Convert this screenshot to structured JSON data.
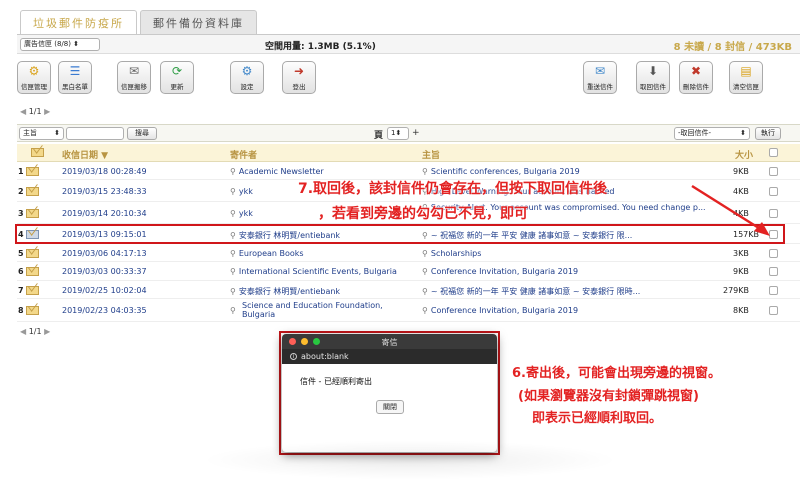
{
  "tabs": [
    {
      "label": "垃圾郵件防疫所",
      "active": true
    },
    {
      "label": "郵件備份資料庫",
      "active": false
    }
  ],
  "topbar": {
    "folder_select": "廣告信匣 (8/8)",
    "quota_label": "空間用量: 1.3MB (5.1%)",
    "mail_count": "8 未讀 / 8 封信 / 473KB"
  },
  "toolbar": {
    "buttons": [
      {
        "label": "信匣管理",
        "icon": "folder-manage-icon"
      },
      {
        "label": "黑白名單",
        "icon": "list-icon"
      },
      {
        "label": "信匣搬移",
        "icon": "move-icon"
      },
      {
        "label": "更新",
        "icon": "refresh-icon"
      },
      {
        "label": "設定",
        "icon": "gear-icon"
      },
      {
        "label": "登出",
        "icon": "logout-icon"
      },
      {
        "label": "重送信件",
        "icon": "resend-icon"
      },
      {
        "label": "取回信件",
        "icon": "retrieve-icon"
      },
      {
        "label": "刪除信件",
        "icon": "delete-icon"
      },
      {
        "label": "清空信匣",
        "icon": "empty-folder-icon"
      }
    ]
  },
  "pager": {
    "page": "1/1"
  },
  "filterbar": {
    "field_select": "主旨",
    "search_value": "",
    "search_button": "搜尋",
    "page_label": "頁",
    "page_select": "1",
    "page_plus": "+",
    "action_select": "-取回信件-",
    "execute_button": "執行"
  },
  "table": {
    "headers": {
      "date": "收信日期",
      "sender": "寄件者",
      "subject": "主旨",
      "size": "大小"
    },
    "rows": [
      {
        "idx": "1",
        "date": "2019/03/18 00:28:49",
        "sender": "Academic Newsletter",
        "subject": "Scientific conferences, Bulgaria 2019",
        "size": "9KB"
      },
      {
        "idx": "2",
        "date": "2019/03/15 23:48:33",
        "sender": "ykk",
        "subject": "High Level Warning: Your account was hacked",
        "size": "4KB"
      },
      {
        "idx": "3",
        "date": "2019/03/14 20:10:34",
        "sender": "ykk",
        "subject": "Security Alert. Your account was compromised. You need change p...",
        "size": "4KB"
      },
      {
        "idx": "4",
        "date": "2019/03/13 09:15:01",
        "sender": "安泰銀行 林明賢/entiebank",
        "subject": "~ 祝福您 新的一年 平安 健康 諸事如意 ~ 安泰銀行 限...",
        "size": "157KB"
      },
      {
        "idx": "5",
        "date": "2019/03/06 04:17:13",
        "sender": "European Books",
        "subject": "Scholarships",
        "size": "3KB"
      },
      {
        "idx": "6",
        "date": "2019/03/03 00:33:37",
        "sender": "International Scientific Events, Bulgaria",
        "subject": "Conference Invitation, Bulgaria 2019",
        "size": "9KB"
      },
      {
        "idx": "7",
        "date": "2019/02/25 10:02:04",
        "sender": "安泰銀行 林明賢/entiebank",
        "subject": "~ 祝福您 新的一年 平安 健康 諸事如意 ~ 安泰銀行 限時...",
        "size": "279KB"
      },
      {
        "idx": "8",
        "date": "2019/02/23 04:03:35",
        "sender": "Science and Education Foundation, Bulgaria",
        "subject": "Conference Invitation, Bulgaria 2019",
        "size": "8KB"
      }
    ]
  },
  "pager_bottom": {
    "page": "1/1"
  },
  "annotation_top": {
    "line1": "7.取回後，該封信件仍會存在，但按下取回信件後",
    "line2": "，若看到旁邊的勾勾已不見，即可"
  },
  "dialog": {
    "title": "寄信",
    "url": "about:blank",
    "message": "信件 - 已經順利寄出",
    "close_button": "關閉"
  },
  "annotation_right": {
    "line1": "6.寄出後，可能會出現旁邊的視窗。",
    "line2": "(如果瀏覽器沒有封鎖彈跳視窗)",
    "line3": "即表示已經順利取回。"
  },
  "colors": {
    "accent_gold": "#c8a84b",
    "annotation_red": "#e32222",
    "link_blue": "#1f3d8a"
  }
}
